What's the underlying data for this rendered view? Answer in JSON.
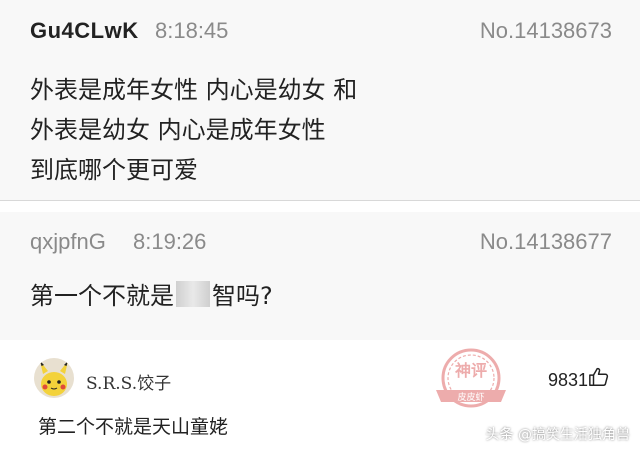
{
  "thread": {
    "posts": [
      {
        "username": "Gu4CLwK",
        "time": "8:18:45",
        "post_no": "No.14138673",
        "lines": [
          "外表是成年女性 内心是幼女 和",
          "外表是幼女 内心是成年女性",
          "到底哪个更可爱"
        ]
      },
      {
        "username": "qxjpfnG",
        "time": "8:19:26",
        "post_no": "No.14138677",
        "text_before": "第一个不就是",
        "text_after": "智吗?"
      }
    ]
  },
  "comment": {
    "username": "S.R.S.饺子",
    "likes": "9831",
    "text": "第二个不就是天山童姥"
  },
  "stamp": {
    "text": "神评",
    "subtext": "皮皮虾"
  },
  "watermark": {
    "text": "头条 @搞笑生活独角兽"
  },
  "colors": {
    "post_bg": "#f8f8f8",
    "meta_gray": "#8a8a8a",
    "stamp_red": "#e06a6a"
  }
}
